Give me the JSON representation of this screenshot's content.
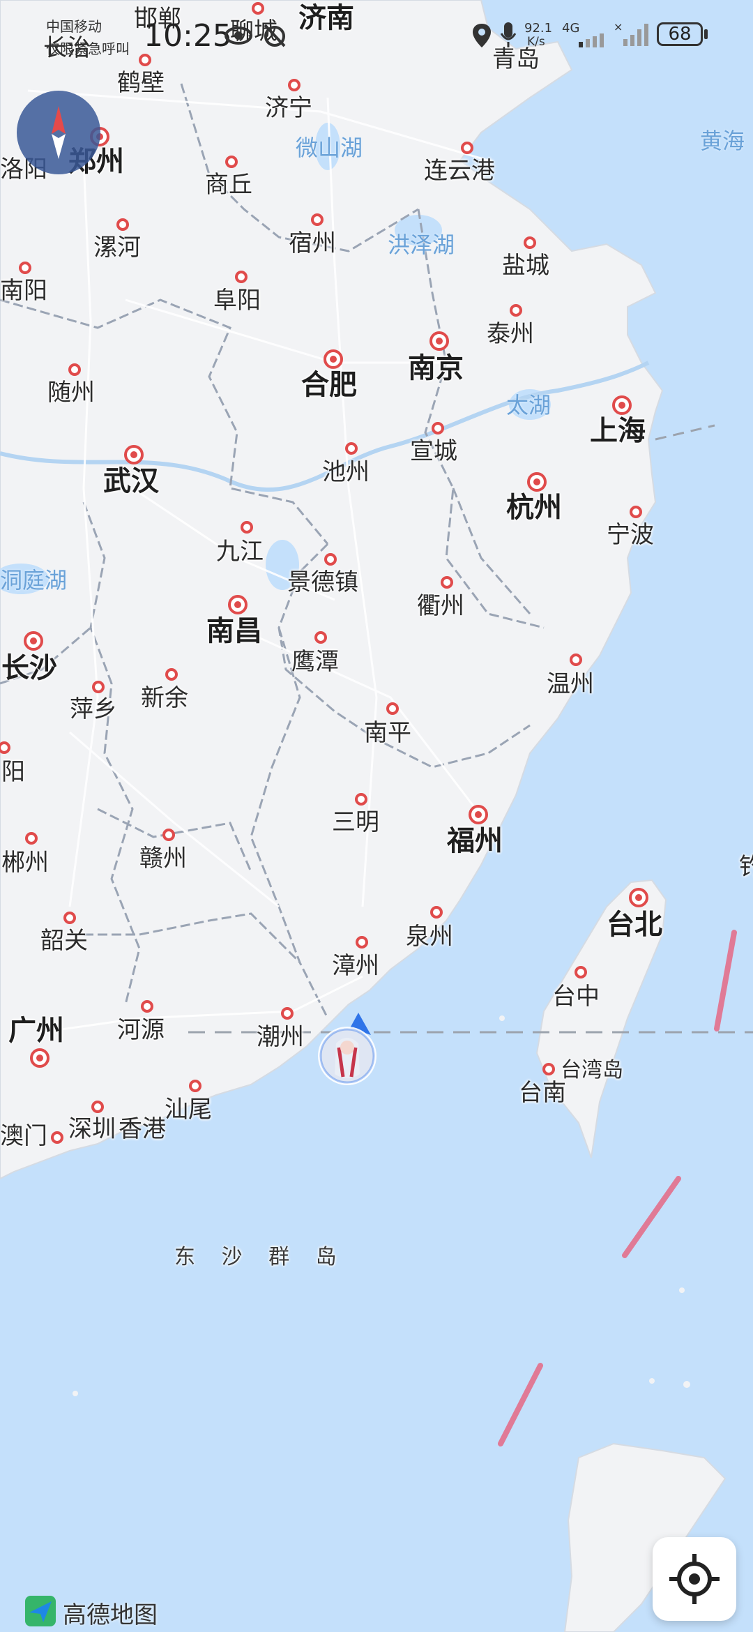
{
  "status_bar": {
    "carrier": "中国移动",
    "emergency": "仅限紧急呼叫",
    "time": "10:25",
    "net_speed_value": "92.1",
    "net_speed_unit": "K/s",
    "network_type": "4G",
    "battery": "68"
  },
  "map": {
    "provider": "高德地图",
    "water_bodies": [
      "微山湖",
      "洪泽湖",
      "太湖",
      "洞庭湖",
      "黄海"
    ],
    "island_group": "东 沙 群 岛",
    "island_name": "台湾岛",
    "provincial_capitals": [
      "郑州",
      "合肥",
      "南京",
      "上海",
      "杭州",
      "武汉",
      "南昌",
      "长沙",
      "福州",
      "台北",
      "广州",
      "济南"
    ],
    "cities": [
      "长治",
      "邯郸",
      "聊城",
      "鹤壁",
      "济宁",
      "洛阳",
      "商丘",
      "连云港",
      "漯河",
      "宿州",
      "盐城",
      "南阳",
      "阜阳",
      "泰州",
      "随州",
      "宣城",
      "池州",
      "宁波",
      "九江",
      "景德镇",
      "衢州",
      "鹰潭",
      "萍乡",
      "新余",
      "温州",
      "南平",
      "阳",
      "三明",
      "郴州",
      "赣州",
      "韶关",
      "泉州",
      "漳州",
      "台中",
      "河源",
      "潮州",
      "汕尾",
      "台南",
      "深圳",
      "香港",
      "澳门",
      "青岛",
      "钓"
    ]
  },
  "controls": {
    "compass_icon": "compass-icon",
    "locate_icon": "crosshair-locate-icon",
    "marker_icon": "user-avatar-location-marker"
  },
  "colors": {
    "sea": "#c4e0fb",
    "land": "#f2f3f5",
    "city_dot": "#e04b4b",
    "compass": "#3a5896",
    "boundary_line": "#e07a96"
  }
}
